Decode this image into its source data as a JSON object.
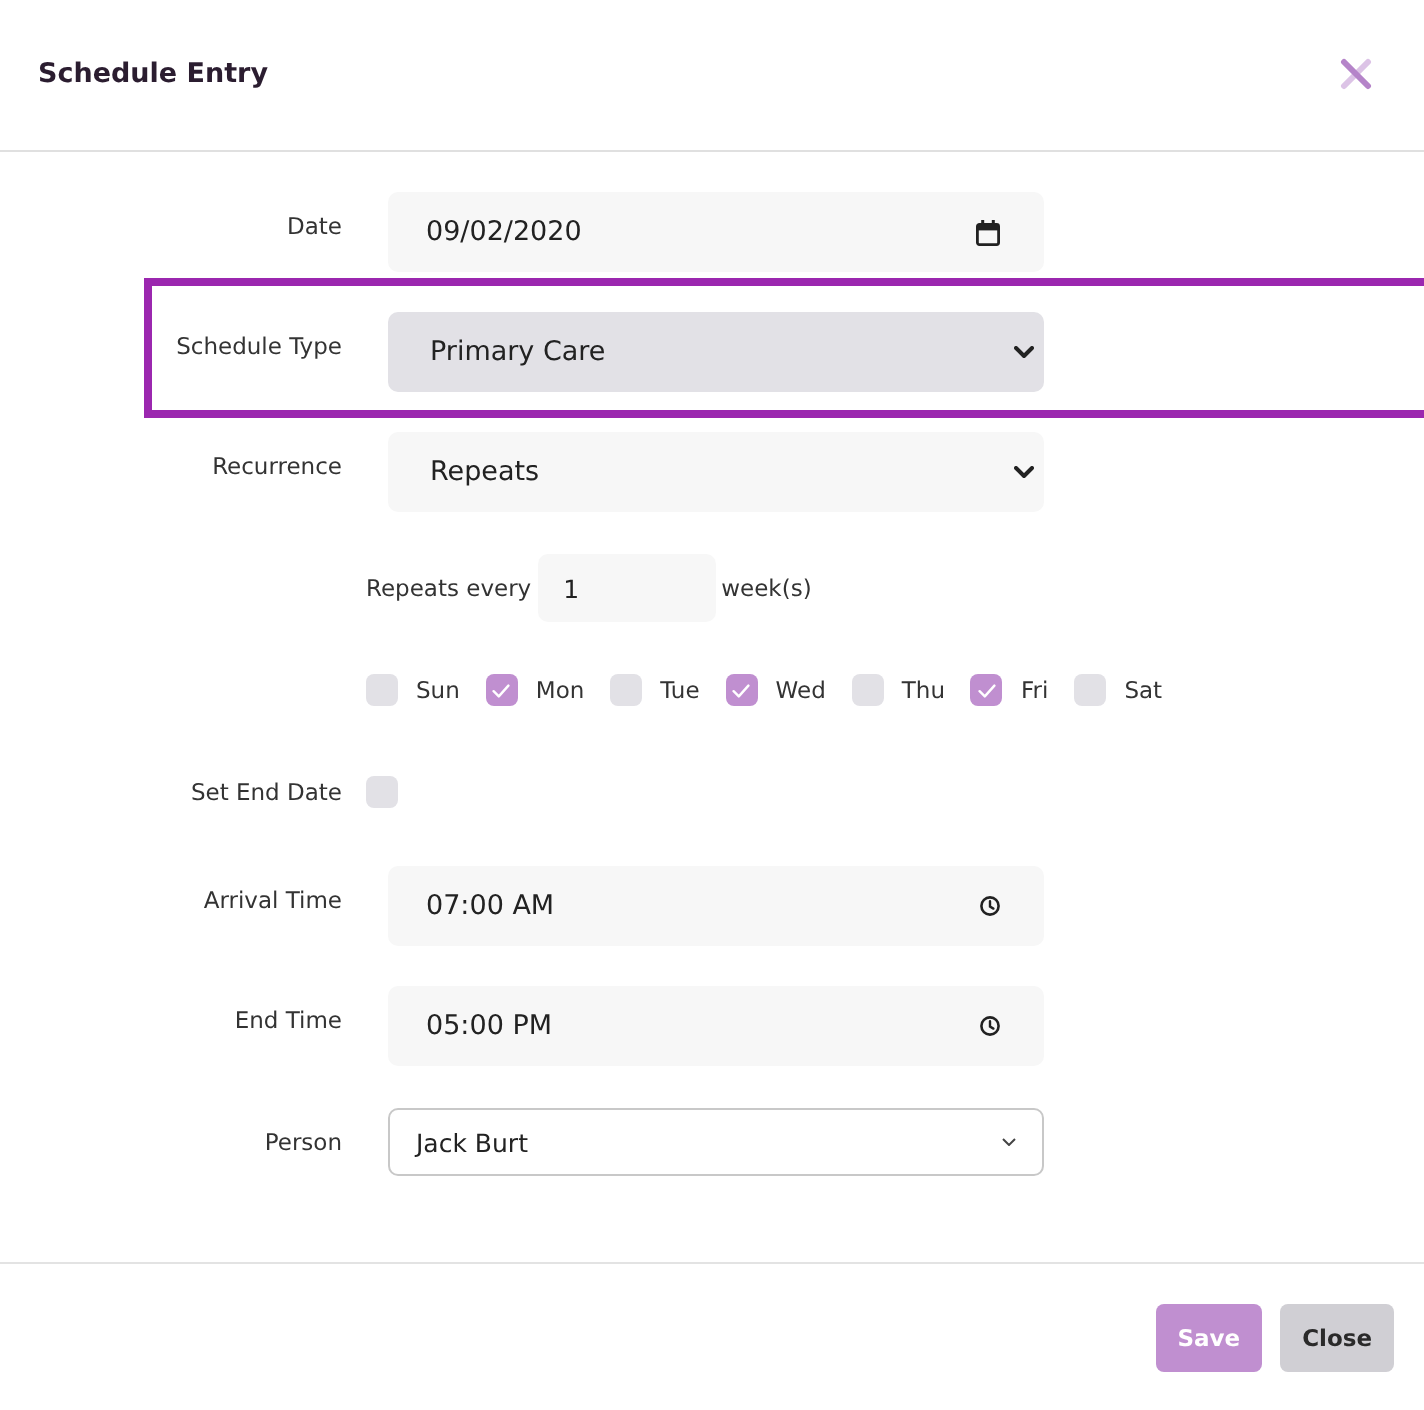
{
  "dialog": {
    "title": "Schedule Entry"
  },
  "fields": [
    {
      "kind": "date",
      "label": "Date",
      "value": "09/02/2020"
    },
    {
      "kind": "select",
      "label": "Schedule Type",
      "value": "Primary Care",
      "highlighted": true
    },
    {
      "kind": "select",
      "label": "Recurrence",
      "value": "Repeats",
      "highlighted": false
    },
    {
      "kind": "repeat",
      "prefix": "Repeats every",
      "value": "1",
      "suffix": "week(s)"
    },
    {
      "kind": "days",
      "days": [
        {
          "label": "Sun",
          "checked": false
        },
        {
          "label": "Mon",
          "checked": true
        },
        {
          "label": "Tue",
          "checked": false
        },
        {
          "label": "Wed",
          "checked": true
        },
        {
          "label": "Thu",
          "checked": false
        },
        {
          "label": "Fri",
          "checked": true
        },
        {
          "label": "Sat",
          "checked": false
        }
      ]
    },
    {
      "kind": "checkbox",
      "label": "Set End Date",
      "checked": false
    },
    {
      "kind": "time",
      "label": "Arrival Time",
      "value": "07:00 AM"
    },
    {
      "kind": "time",
      "label": "End Time",
      "value": "05:00 PM"
    },
    {
      "kind": "dropdown",
      "label": "Person",
      "value": "Jack Burt"
    }
  ],
  "buttons": [
    {
      "kind": "primary",
      "label": "Save"
    },
    {
      "kind": "secondary",
      "label": "Close"
    }
  ]
}
